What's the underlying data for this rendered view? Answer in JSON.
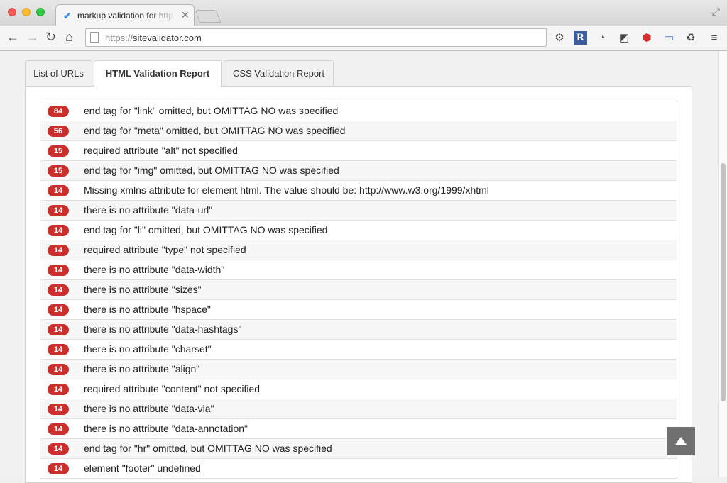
{
  "browser": {
    "tab_title": "markup validation for http",
    "tab_icon": "checkmark-icon",
    "url_scheme": "https://",
    "url_host": "sitevalidator.com"
  },
  "tabs": [
    {
      "label": "List of URLs",
      "active": false
    },
    {
      "label": "HTML Validation Report",
      "active": true
    },
    {
      "label": "CSS Validation Report",
      "active": false
    }
  ],
  "colors": {
    "badge": "#c9302c"
  },
  "errors": [
    {
      "count": "84",
      "message": "end tag for \"link\" omitted, but OMITTAG NO was specified"
    },
    {
      "count": "56",
      "message": "end tag for \"meta\" omitted, but OMITTAG NO was specified"
    },
    {
      "count": "15",
      "message": "required attribute \"alt\" not specified"
    },
    {
      "count": "15",
      "message": "end tag for \"img\" omitted, but OMITTAG NO was specified"
    },
    {
      "count": "14",
      "message": "Missing xmlns attribute for element html. The value should be: http://www.w3.org/1999/xhtml"
    },
    {
      "count": "14",
      "message": "there is no attribute \"data-url\""
    },
    {
      "count": "14",
      "message": "end tag for \"li\" omitted, but OMITTAG NO was specified"
    },
    {
      "count": "14",
      "message": "required attribute \"type\" not specified"
    },
    {
      "count": "14",
      "message": "there is no attribute \"data-width\""
    },
    {
      "count": "14",
      "message": "there is no attribute \"sizes\""
    },
    {
      "count": "14",
      "message": "there is no attribute \"hspace\""
    },
    {
      "count": "14",
      "message": "there is no attribute \"data-hashtags\""
    },
    {
      "count": "14",
      "message": "there is no attribute \"charset\""
    },
    {
      "count": "14",
      "message": "there is no attribute \"align\""
    },
    {
      "count": "14",
      "message": "required attribute \"content\" not specified"
    },
    {
      "count": "14",
      "message": "there is no attribute \"data-via\""
    },
    {
      "count": "14",
      "message": "there is no attribute \"data-annotation\""
    },
    {
      "count": "14",
      "message": "end tag for \"hr\" omitted, but OMITTAG NO was specified"
    },
    {
      "count": "14",
      "message": "element \"footer\" undefined"
    }
  ]
}
